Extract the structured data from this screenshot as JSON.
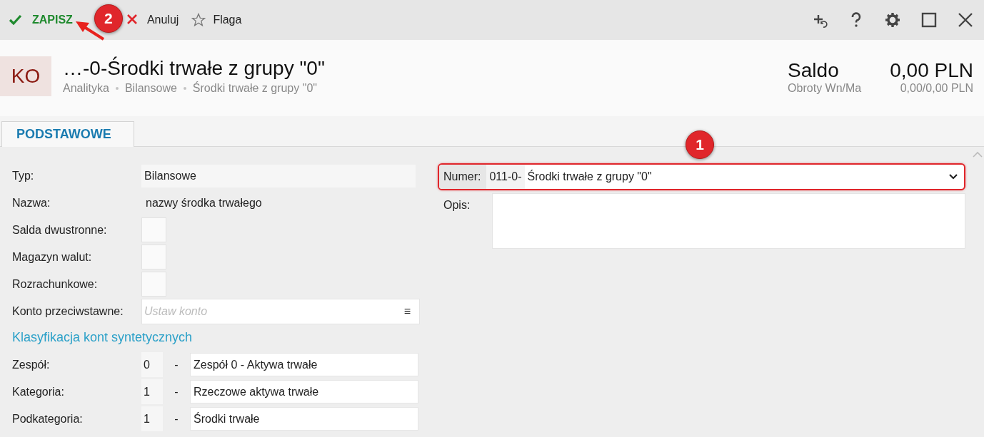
{
  "toolbar": {
    "actions": [
      {
        "kind": "save",
        "label": "ZAPISZ",
        "callout": "2"
      },
      {
        "kind": "cancel",
        "label": "Anuluj"
      },
      {
        "kind": "flag",
        "label": "Flaga"
      }
    ]
  },
  "header": {
    "badge": "KO",
    "title": "…-0-Środki trwałe z grupy \"0\"",
    "breadcrumb": [
      "Analityka",
      "Bilansowe",
      "Środki trwałe z grupy \"0\""
    ],
    "balance_label": "Saldo",
    "balance": "0,00 PLN",
    "turnover_label": "Obroty Wn/Ma",
    "turnover": "0,00/0,00 PLN"
  },
  "tabs": [
    {
      "label": "PODSTAWOWE",
      "selected": true
    }
  ],
  "fields": [
    {
      "kind": "shaded",
      "label": "Typ:",
      "value": "Bilansowe"
    },
    {
      "kind": "plain",
      "label": "Nazwa:",
      "value": "nazwy środka trwałego"
    },
    {
      "kind": "checkbox",
      "label": "Salda dwustronne:",
      "checked": false
    },
    {
      "kind": "checkbox",
      "label": "Magazyn walut:",
      "checked": false
    },
    {
      "kind": "checkbox",
      "label": "Rozrachunkowe:",
      "checked": false
    },
    {
      "kind": "lookup",
      "label": "Konto przeciwstawne:",
      "placeholder": "Ustaw konto",
      "menu_glyph": "≡"
    }
  ],
  "classification": {
    "title": "Klasyfikacja kont syntetycznych",
    "rows": [
      {
        "label": "Zespół:",
        "code": "0",
        "separator": "-",
        "name": "Zespół 0 - Aktywa trwałe"
      },
      {
        "label": "Kategoria:",
        "code": "1",
        "separator": "-",
        "name": "Rzeczowe aktywa trwałe"
      },
      {
        "label": "Podkategoria:",
        "code": "1",
        "separator": "-",
        "name": "Środki trwałe"
      }
    ]
  },
  "numer": {
    "label": "Numer:",
    "prefix": "011-0-",
    "value": "Środki trwałe z grupy \"0\"",
    "highlighted": true,
    "callout": "1"
  },
  "opis": {
    "label": "Opis:"
  }
}
